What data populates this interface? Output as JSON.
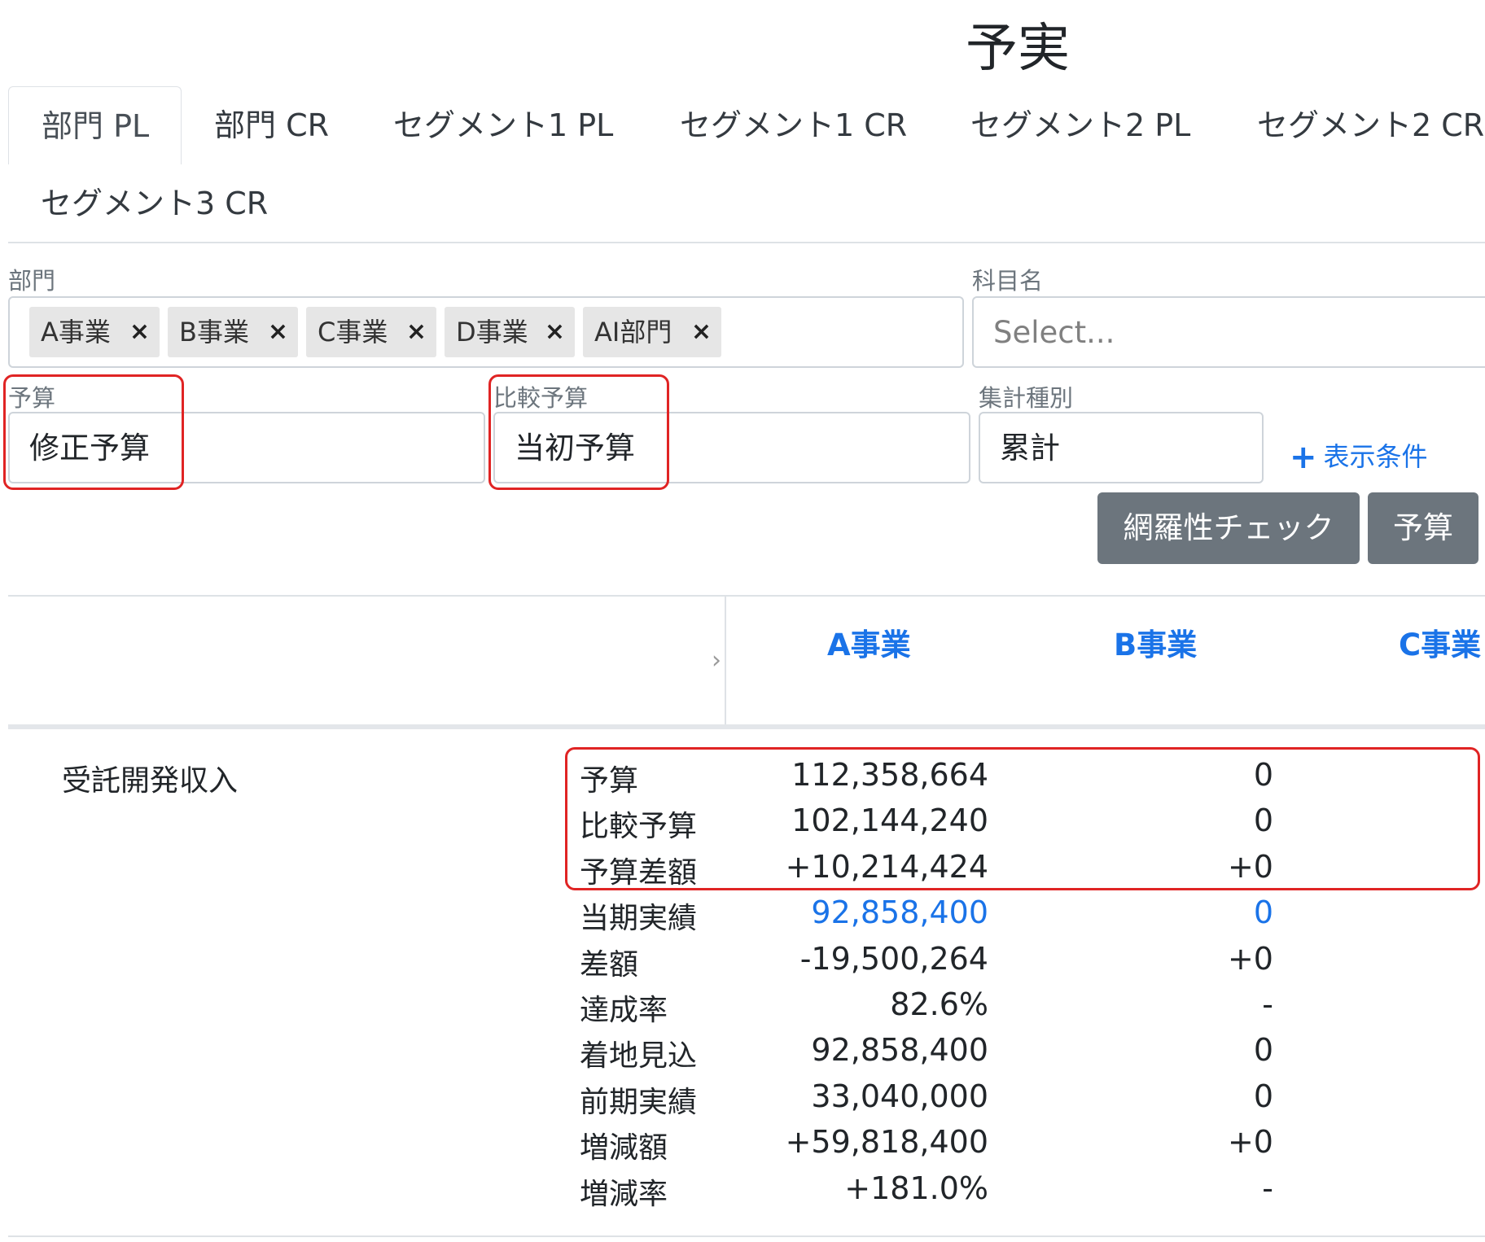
{
  "page_title": "予実",
  "tabs": [
    {
      "label": "部門 PL",
      "active": true
    },
    {
      "label": "部門 CR"
    },
    {
      "label": "セグメント1 PL"
    },
    {
      "label": "セグメント1 CR"
    },
    {
      "label": "セグメント2 PL"
    },
    {
      "label": "セグメント2 CR"
    },
    {
      "label": "セグメント3 CR"
    }
  ],
  "filters": {
    "department": {
      "label": "部門",
      "chips": [
        "A事業",
        "B事業",
        "C事業",
        "D事業",
        "AI部門"
      ],
      "remove_glyph": "×"
    },
    "account": {
      "label": "科目名",
      "placeholder": "Select..."
    },
    "budget": {
      "label": "予算",
      "value": "修正予算"
    },
    "compare_budget": {
      "label": "比較予算",
      "value": "当初予算"
    },
    "aggregation": {
      "label": "集計種別",
      "value": "累計"
    },
    "add_condition": {
      "icon": "plus-icon",
      "plus": "+",
      "label": "表示条件"
    }
  },
  "buttons": {
    "coverage_check": "網羅性チェック",
    "budget": "予算"
  },
  "table": {
    "expand_glyph": "›",
    "columns": [
      "A事業",
      "B事業",
      "C事業"
    ],
    "row_label": "受託開発収入",
    "metrics": [
      {
        "label": "予算",
        "a": "112,358,664",
        "b": "0"
      },
      {
        "label": "比較予算",
        "a": "102,144,240",
        "b": "0"
      },
      {
        "label": "予算差額",
        "a": "+10,214,424",
        "b": "+0"
      },
      {
        "label": "当期実績",
        "a": "92,858,400",
        "b": "0",
        "link": true
      },
      {
        "label": "差額",
        "a": "-19,500,264",
        "b": "+0"
      },
      {
        "label": "達成率",
        "a": "82.6%",
        "b": "-"
      },
      {
        "label": "着地見込",
        "a": "92,858,400",
        "b": "0"
      },
      {
        "label": "前期実績",
        "a": "33,040,000",
        "b": "0"
      },
      {
        "label": "増減額",
        "a": "+59,818,400",
        "b": "+0"
      },
      {
        "label": "増減率",
        "a": "+181.0%",
        "b": "-"
      }
    ]
  },
  "colors": {
    "accent": "#1a73e8",
    "highlight": "#e02424",
    "button": "#6c757d"
  }
}
